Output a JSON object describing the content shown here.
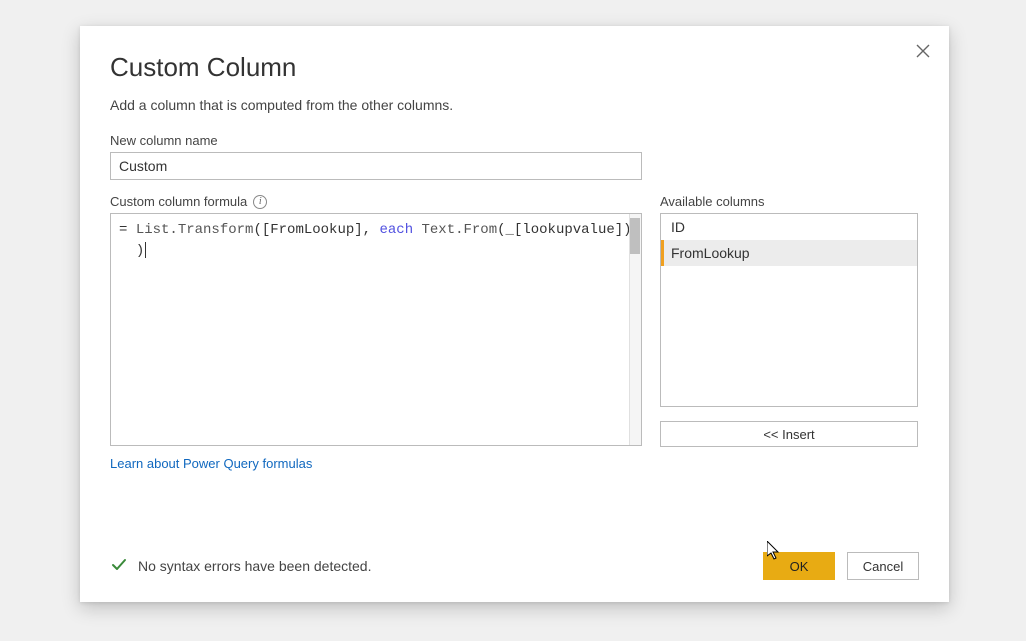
{
  "dialog": {
    "title": "Custom Column",
    "subtitle": "Add a column that is computed from the other columns.",
    "new_column_label": "New column name",
    "new_column_value": "Custom",
    "formula_label": "Custom column formula",
    "formula": {
      "raw": "= List.Transform([FromLookup], each Text.From(_[lookupvalue]) )",
      "eq": "= ",
      "fn1": "List.Transform",
      "paren1": "(",
      "field1": "[FromLookup]",
      "comma": ", ",
      "each": "each",
      "space": " ",
      "fn2": "Text.From",
      "paren2": "(",
      "under": "_",
      "field2": "[lookupvalue]",
      "close1": ")",
      "close2": ")",
      "line2_close": ")"
    },
    "available_label": "Available columns",
    "available_columns": {
      "0": "ID",
      "1": "FromLookup"
    },
    "insert_label": "<< Insert",
    "learn_link": "Learn about Power Query formulas",
    "status_text": "No syntax errors have been detected.",
    "ok_label": "OK",
    "cancel_label": "Cancel"
  }
}
